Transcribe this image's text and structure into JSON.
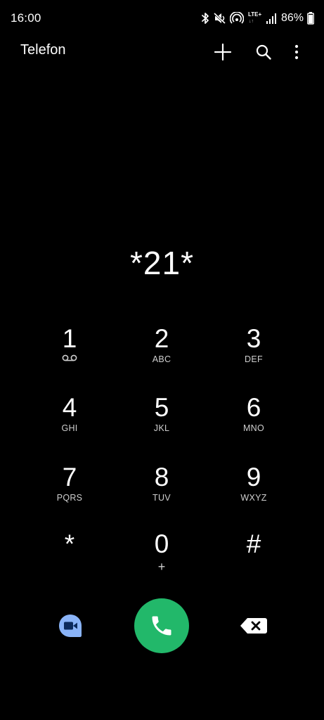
{
  "status_bar": {
    "time": "16:00",
    "battery_percent": "86%",
    "network_label": "LTE+",
    "network_arrows": "↓↑",
    "icons": [
      "bluetooth-icon",
      "mute-icon",
      "hotspot-icon",
      "lte-icon",
      "signal-icon",
      "battery-icon"
    ]
  },
  "header": {
    "title": "Telefon",
    "actions": [
      "add-icon",
      "search-icon",
      "more-icon"
    ]
  },
  "dialer": {
    "number": "*21*"
  },
  "keypad": {
    "keys": [
      {
        "digit": "1",
        "letters": "",
        "sub_icon": "voicemail-icon"
      },
      {
        "digit": "2",
        "letters": "ABC"
      },
      {
        "digit": "3",
        "letters": "DEF"
      },
      {
        "digit": "4",
        "letters": "GHI"
      },
      {
        "digit": "5",
        "letters": "JKL"
      },
      {
        "digit": "6",
        "letters": "MNO"
      },
      {
        "digit": "7",
        "letters": "PQRS"
      },
      {
        "digit": "8",
        "letters": "TUV"
      },
      {
        "digit": "9",
        "letters": "WXYZ"
      },
      {
        "digit": "*",
        "letters": ""
      },
      {
        "digit": "0",
        "letters": "+"
      },
      {
        "digit": "#",
        "letters": ""
      }
    ]
  },
  "actions": {
    "video_call_icon": "video-call-icon",
    "call_icon": "phone-icon",
    "backspace_icon": "backspace-icon"
  },
  "colors": {
    "background": "#000000",
    "text": "#ffffff",
    "call_button": "#22b86a",
    "video_button": "#8ab4f8",
    "secondary_text": "#cfcfcf"
  }
}
